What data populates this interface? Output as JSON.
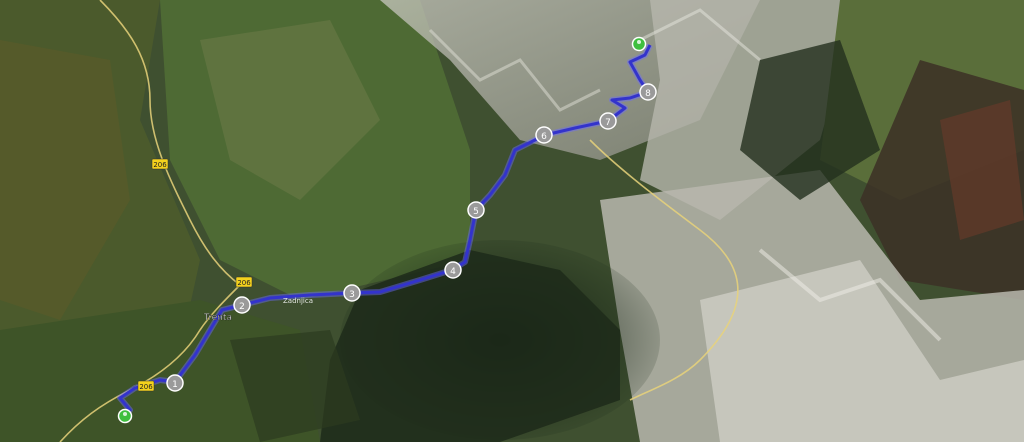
{
  "map": {
    "place_labels": [
      {
        "id": "trenta",
        "text": "Trenta"
      },
      {
        "id": "zadnjica",
        "text": "Zadnjica"
      }
    ],
    "road_badges": [
      {
        "id": "road-206-north",
        "text": "206"
      },
      {
        "id": "road-206-middle",
        "text": "206"
      },
      {
        "id": "road-206-south",
        "text": "206"
      }
    ],
    "waypoints": [
      {
        "id": "wp1",
        "text": "1"
      },
      {
        "id": "wp2",
        "text": "2"
      },
      {
        "id": "wp3",
        "text": "3"
      },
      {
        "id": "wp4",
        "text": "4"
      },
      {
        "id": "wp5",
        "text": "5"
      },
      {
        "id": "wp6",
        "text": "6"
      },
      {
        "id": "wp7",
        "text": "7"
      },
      {
        "id": "wp8",
        "text": "8"
      }
    ],
    "markers": [
      {
        "id": "start",
        "color": "#3fbf3f"
      },
      {
        "id": "end",
        "color": "#3fbf3f"
      }
    ],
    "colors": {
      "track": "#3333cc",
      "track_glow": "#6a6aff",
      "road": "#e8d27a",
      "badge_bg": "#f4d21c",
      "waypoint_bg": "#9a9a9a"
    }
  }
}
